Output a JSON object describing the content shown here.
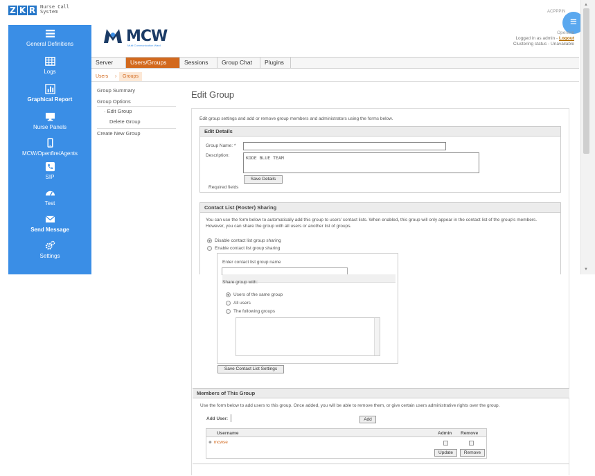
{
  "brand": {
    "letters": [
      "Z",
      "K",
      "R"
    ],
    "sub1": "Nurse Call",
    "sub2": "System"
  },
  "topright": {
    "label": "ACPPPIN"
  },
  "sidebar": {
    "items": [
      {
        "label": "General Definitions",
        "icon": "list-icon",
        "bold": false
      },
      {
        "label": "Logs",
        "icon": "table-icon",
        "bold": false
      },
      {
        "label": "Graphical Report",
        "icon": "bar-chart-icon",
        "bold": true
      },
      {
        "label": "Nurse Panels",
        "icon": "monitor-icon",
        "bold": false
      },
      {
        "label": "MCW/Openfire/Agents",
        "icon": "mobile-icon",
        "bold": false
      },
      {
        "label": "SIP",
        "icon": "phone-icon",
        "bold": false
      },
      {
        "label": "Test",
        "icon": "dashboard-icon",
        "bold": false
      },
      {
        "label": "Send Message",
        "icon": "envelope-icon",
        "bold": true
      },
      {
        "label": "Settings",
        "icon": "cogs-icon",
        "bold": false
      }
    ]
  },
  "header": {
    "logo_text": "MCW",
    "logo_sub": "Multi Communication Ward",
    "app_name": "Openfire",
    "logged_in": "Logged in as admin -",
    "logout": "Logout",
    "clustering": "Clustering status - Unavailable"
  },
  "tabs": [
    "Server",
    "Users/Groups",
    "Sessions",
    "Group Chat",
    "Plugins"
  ],
  "active_tab": 1,
  "subtabs": [
    "Users",
    "Groups"
  ],
  "leftnav": [
    "Group Summary",
    "Group Options",
    "· Edit Group",
    "Delete Group",
    "Create New Group"
  ],
  "page_title": "Edit Group",
  "intro": "Edit group settings and add or remove group members and administrators using the forms below.",
  "edit_details": {
    "title": "Edit Details",
    "name_label": "Group Name: *",
    "name_value": "",
    "desc_label": "Description:",
    "desc_value": "KODE BLUE TEAM",
    "save_btn": "Save Details",
    "required": "Required fields"
  },
  "contact": {
    "title": "Contact List (Roster) Sharing",
    "desc": "You can use the form below to automatically add this group to users' contact lists. When enabled, this group will only appear in the contact list of the group's members. However, you can share the group with all users or another list of groups.",
    "opt_disable": "Disable contact list group sharing",
    "opt_enable": "Enable contact list group sharing",
    "enter_name": "Enter contact list group name",
    "share_with": "Share group with:",
    "share_opts": [
      "Users of the same group",
      "All users",
      "The following groups"
    ],
    "save_btn": "Save Contact List Settings"
  },
  "members": {
    "title": "Members of This Group",
    "desc": "Use the form below to add users to this group. Once added, you will be able to remove them, or give certain users administrative rights over the group.",
    "add_user_label": "Add User:",
    "add_btn": "Add",
    "col_user": "Username",
    "col_admin": "Admin",
    "col_remove": "Remove",
    "rows": [
      {
        "user": "mcwse"
      }
    ],
    "update_btn": "Update",
    "remove_btn": "Remove"
  }
}
